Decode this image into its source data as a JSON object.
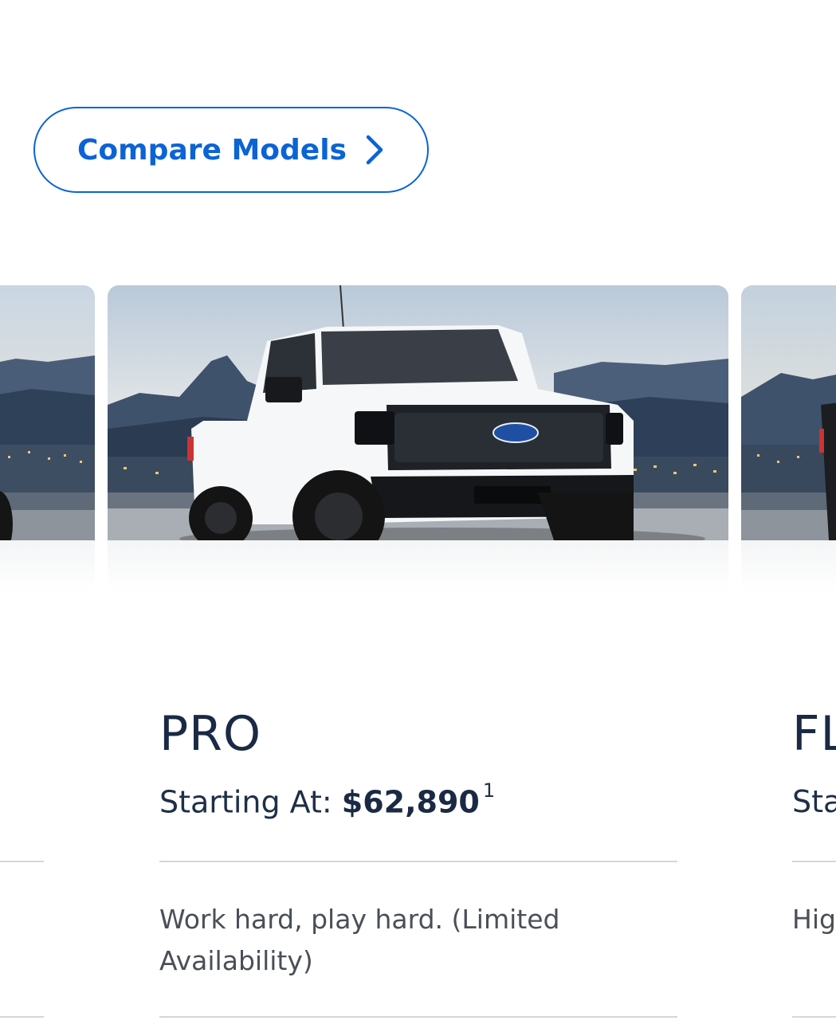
{
  "compare": {
    "label": "Compare Models"
  },
  "cards": {
    "center": {
      "title": "PRO",
      "price_label": "Starting At:",
      "price": "$62,890",
      "footnote": "1",
      "description": "Work hard, play hard. (Limited Availability)"
    },
    "right": {
      "title": "FL",
      "price_label_partial": "Sta",
      "description_partial": "Hig"
    }
  },
  "colors": {
    "accent": "#0b63d6",
    "heading": "#1a2a44",
    "truck_body": "#ffffff",
    "ford_badge": "#1f4fa3"
  },
  "icons": {
    "compare": "chevron-right-icon"
  }
}
